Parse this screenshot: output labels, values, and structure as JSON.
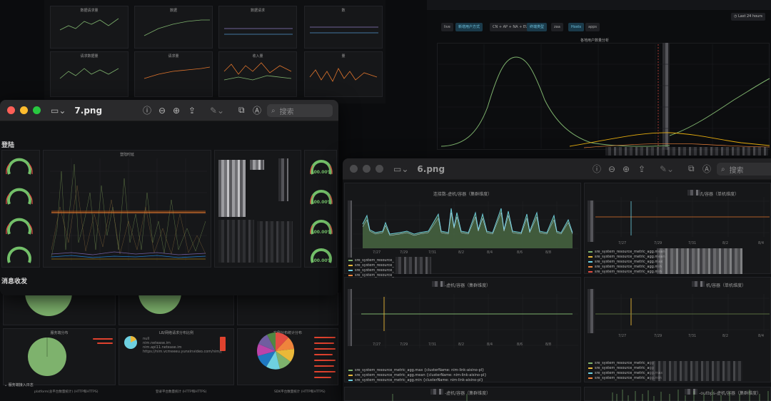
{
  "window_7": {
    "filename": "7.png",
    "search_placeholder": "搜索",
    "section_login": "登陆",
    "section_message": "消息收发",
    "gauges": [
      "100.00%",
      "100.00%",
      "100.00%",
      "100.00%"
    ]
  },
  "window_6": {
    "filename": "6.png",
    "search_placeholder": "搜索",
    "panel1_title": "连接数-虚机/容器（集群维度）",
    "panel2_title": "机/容器（单机维度）",
    "panel3_title": "-虚机/容器（集群维度）",
    "panel4_title": "机/容器（单机维度）",
    "panel5_title": "-虚机/容器（集群维度）",
    "panel6_title": "-outbps-虚机/容器（集群维度）",
    "dates_a": [
      "7/27",
      "7/29",
      "7/31",
      "8/2",
      "8/4",
      "8/6",
      "8/8"
    ],
    "dates_b": [
      "7/27",
      "7/29",
      "7/31",
      "8/2",
      "8/4"
    ],
    "dates_c": [
      "7/27",
      "7/29",
      "7/31",
      "8/2",
      "8/4",
      "8/6",
      "8/8"
    ],
    "legend_p1": [
      "sre_system_resource_",
      "sre_system_resource_",
      "sre_system_resource_",
      "sre_system_resource_"
    ],
    "legend_p2": [
      "sre_system_resource_metric_agg.mean",
      "sre_system_resource_metric_agg.mean",
      "sre_system_resource_metric_agg.max",
      "sre_system_resource_metric_agg.min",
      "sre_system_resource_metric_agg.min"
    ],
    "legend_p3": [
      "sre_system_resource_metric_agg.max {clusterName: nim-link-aisino-pl}",
      "sre_system_resource_metric_agg.mean {clusterName: nim-link-aisino-pl}",
      "sre_system_resource_metric_agg.min {clusterName: nim-link-aisino-pl}"
    ],
    "legend_p4": [
      "sre_system_resource_metric_agg",
      "sre_system_resource_metric_agg",
      "sre_system_resource_metric_agg.max",
      "sre_system_resource_metric_agg.min"
    ]
  },
  "bottom_dash": {
    "section_label": "服务端接入日志",
    "col_labels": [
      "platform(总平台数量统计) (HTTP和HTTPS)",
      "登录平台数量统计 (HTTP和HTTPS)",
      "SDK平台数量统计 (HTTP和HTTPS)"
    ],
    "panel_titles": [
      "服务端分布",
      "LB/网络请求分布比例",
      "实例分布统计分布"
    ],
    "lb_legend": [
      "null",
      "nim.netease.im",
      "nim.api11.netease.im",
      "https://nim.vcmeeeu.yunxinvideo.com/nim/pvd/lvnsamlinka.sohu"
    ]
  },
  "right_dash": {
    "time_picker": "Last 24 hours",
    "chart_title": "各地用户数量分析",
    "pills": [
      "live",
      "新增用户方式",
      "CN + AP + NA + EU",
      "终端类型",
      "zaa",
      "Hosts",
      "apps"
    ]
  },
  "colors": {
    "gauge_green": "#73bf69",
    "dark_bg": "#111214",
    "panel_bg": "#161719"
  }
}
